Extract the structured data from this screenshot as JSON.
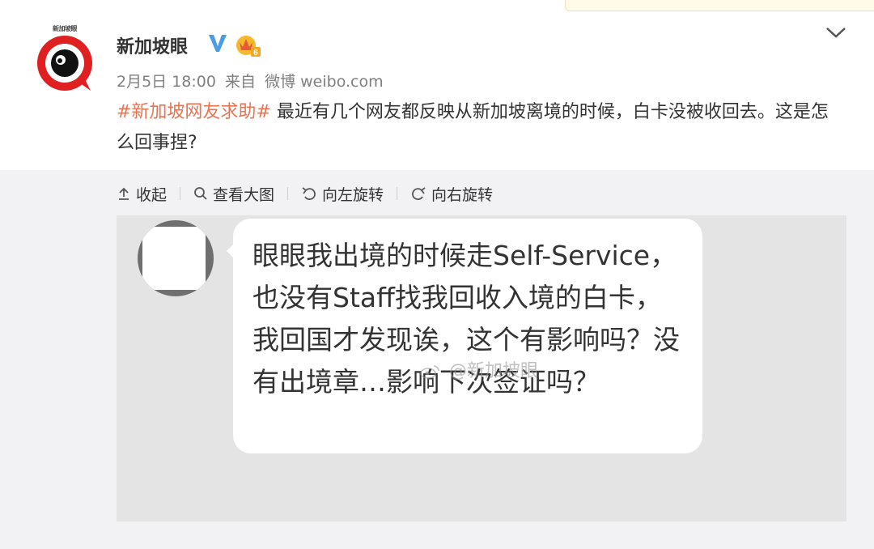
{
  "post": {
    "author": "新加坡眼",
    "avatar_text": "新加坡眼",
    "meta_date": "2月5日 18:00",
    "meta_from": "来自",
    "meta_source": "微博 weibo.com",
    "hashtag": "#新加坡网友求助#",
    "body": " 最近有几个网友都反映从新加坡离境的时候，白卡没被收回去。这是怎么回事捏?"
  },
  "badges": {
    "vip_level": "6"
  },
  "toolbar": {
    "collapse": "收起",
    "view_large": "查看大图",
    "rotate_left": "向左旋转",
    "rotate_right": "向右旋转"
  },
  "chat": {
    "message": "眼眼我出境的时候走Self-Service，也没有Staff找我回收入境的白卡，我回国才发现诶，这个有影响吗？没有出境章…影响下次签证吗？",
    "watermark": "@新加坡眼"
  },
  "colors": {
    "hashtag": "#eb7350",
    "verified": "#4a9ce8",
    "crown": "#f5b82e",
    "logo_red": "#e02020"
  }
}
